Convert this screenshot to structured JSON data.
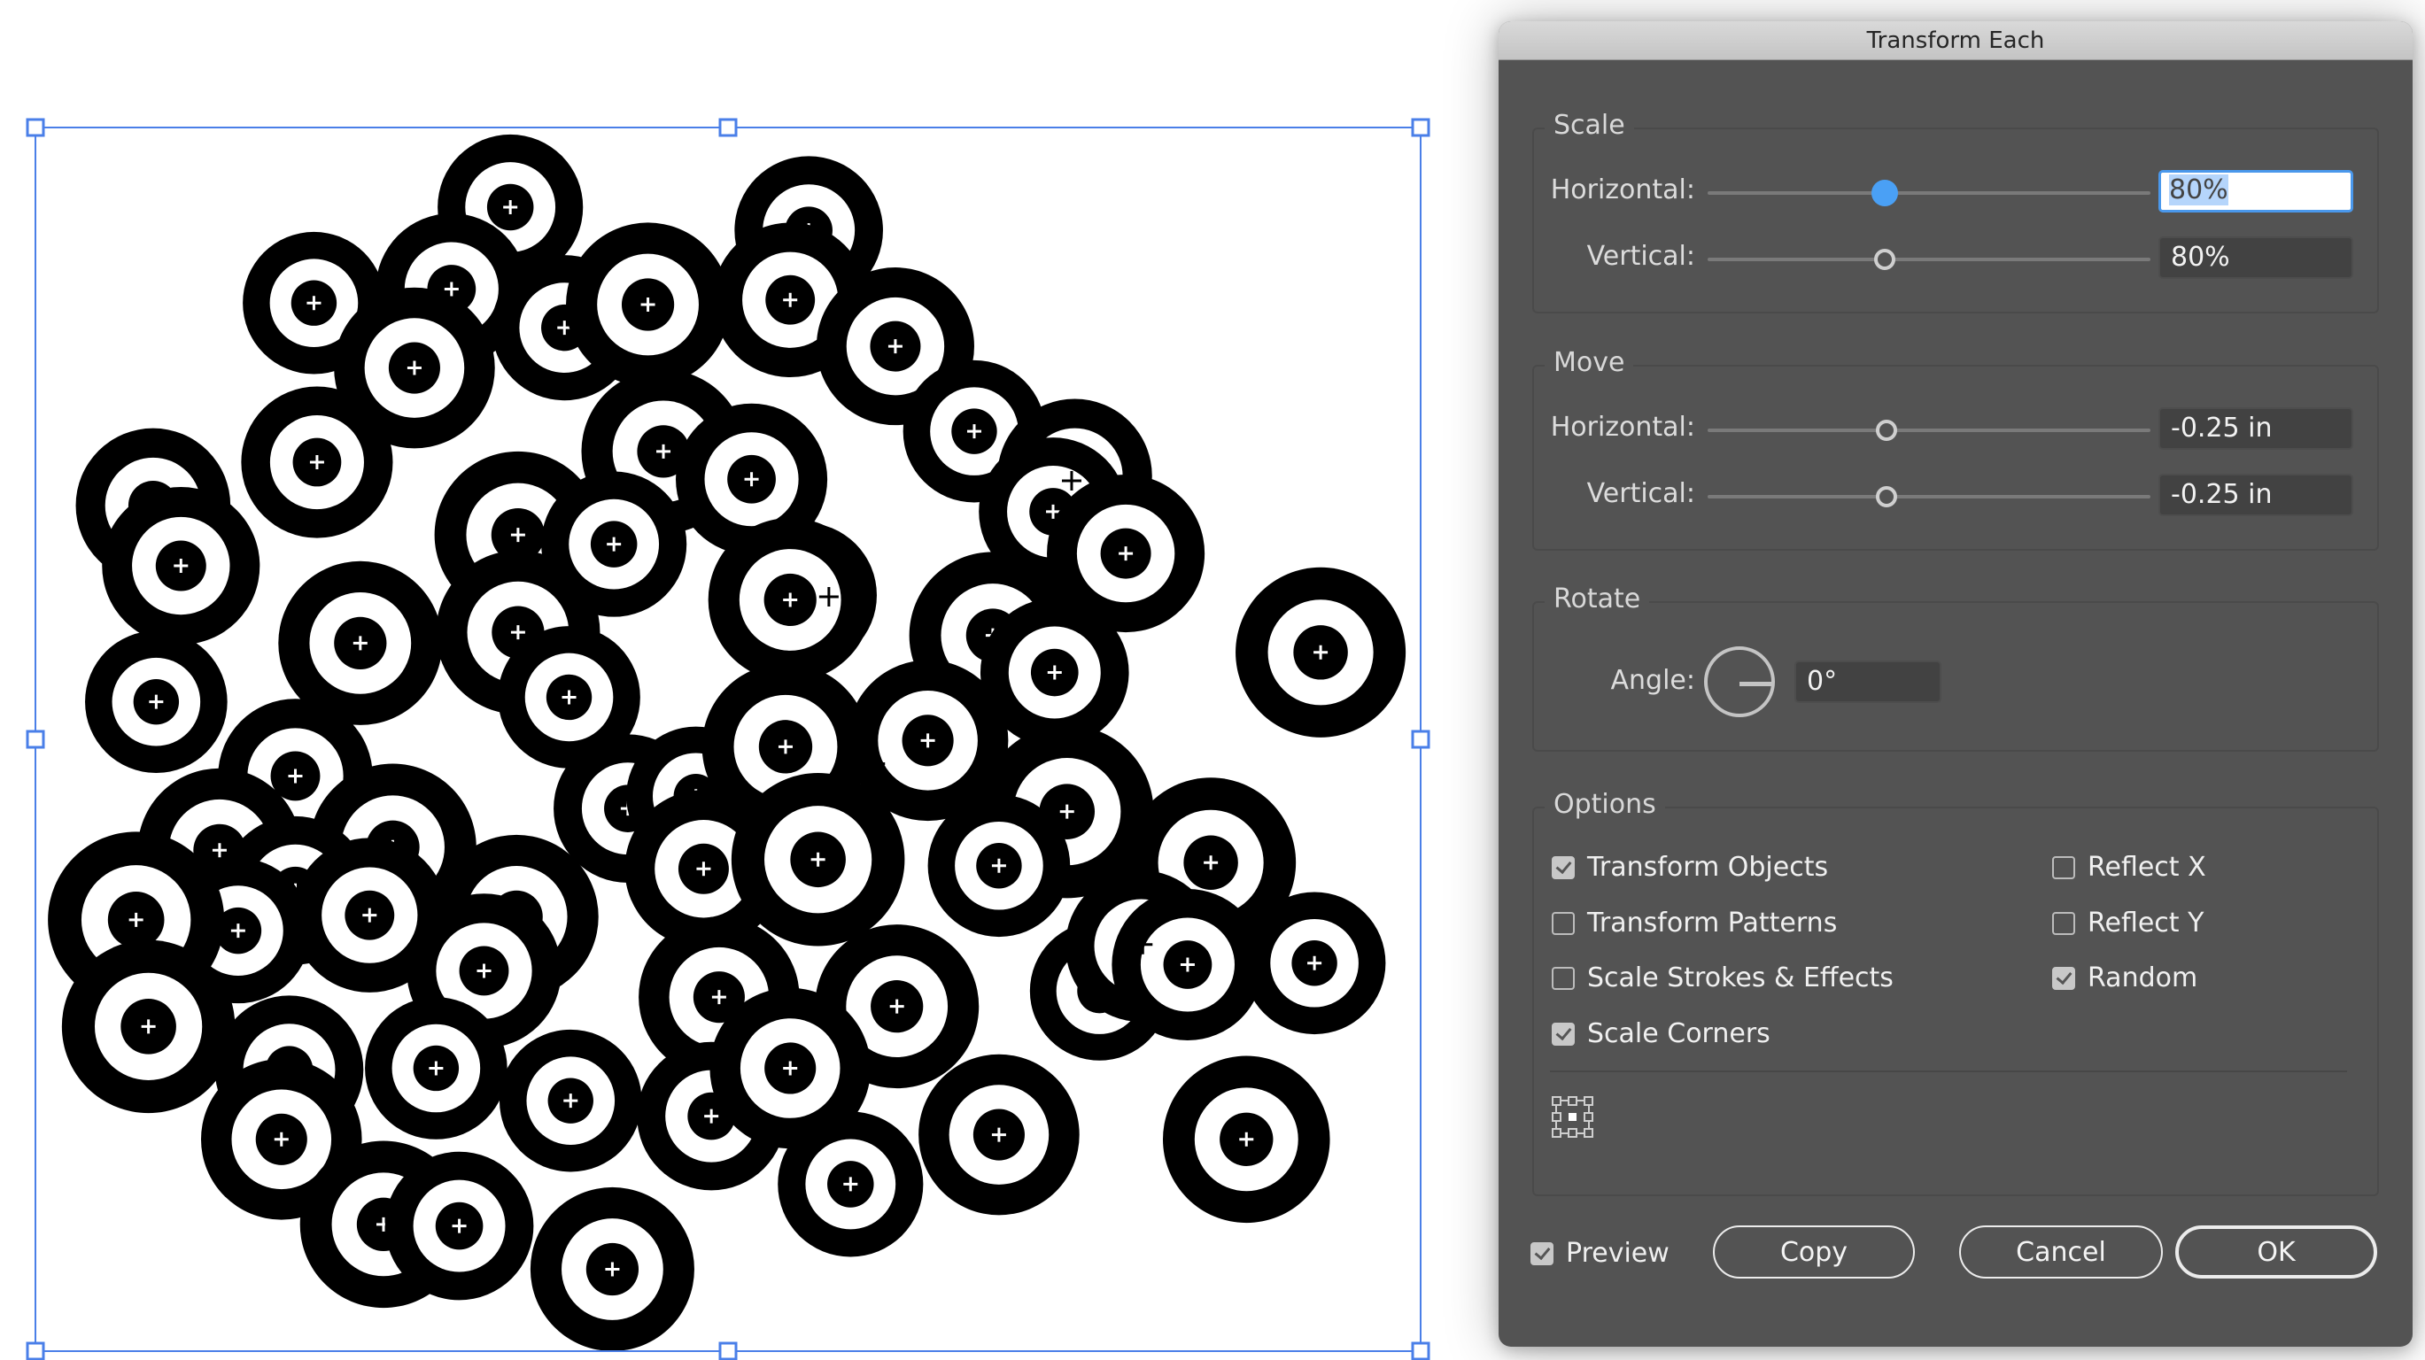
{
  "canvas": {
    "description": "Selected group of concentric black/white ring objects with bounding box",
    "selection_color": "#4a7fe8"
  },
  "dialog": {
    "title": "Transform Each",
    "scale": {
      "legend": "Scale",
      "horizontal_label": "Horizontal:",
      "horizontal_value": "80%",
      "horizontal_slider_percent": 80,
      "vertical_label": "Vertical:",
      "vertical_value": "80%",
      "vertical_slider_percent": 80
    },
    "move": {
      "legend": "Move",
      "horizontal_label": "Horizontal:",
      "horizontal_value": "-0.25 in",
      "vertical_label": "Vertical:",
      "vertical_value": "-0.25 in"
    },
    "rotate": {
      "legend": "Rotate",
      "angle_label": "Angle:",
      "angle_value": "0°"
    },
    "options": {
      "legend": "Options",
      "checkboxes": [
        {
          "label": "Transform Objects",
          "checked": true
        },
        {
          "label": "Transform Patterns",
          "checked": false
        },
        {
          "label": "Scale Strokes & Effects",
          "checked": false
        },
        {
          "label": "Scale Corners",
          "checked": true
        },
        {
          "label": "Reflect X",
          "checked": false
        },
        {
          "label": "Reflect Y",
          "checked": false
        },
        {
          "label": "Random",
          "checked": true
        }
      ],
      "reference_point": "center"
    },
    "preview": {
      "label": "Preview",
      "checked": true
    },
    "buttons": {
      "copy": "Copy",
      "cancel": "Cancel",
      "ok": "OK"
    },
    "accent_color": "#4aa0f5"
  }
}
